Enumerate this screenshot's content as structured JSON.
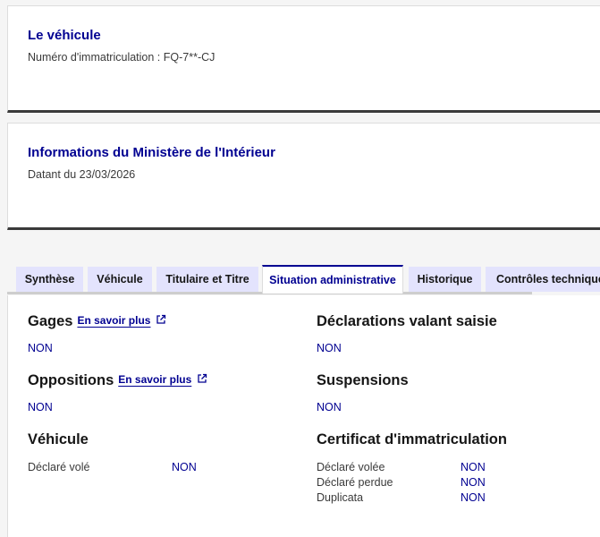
{
  "vehicle_card": {
    "title": "Le véhicule",
    "plate_label": "Numéro d'immatriculation : FQ-7**-CJ"
  },
  "ministry_card": {
    "title": "Informations du Ministère de l'Intérieur",
    "date_label": "Datant du 23/03/2026"
  },
  "tabs": [
    {
      "label": "Synthèse"
    },
    {
      "label": "Véhicule"
    },
    {
      "label": "Titulaire et Titre"
    },
    {
      "label": "Situation administrative",
      "active": true
    },
    {
      "label": "Historique"
    },
    {
      "label": "Contrôles techniques"
    }
  ],
  "sections": {
    "gages": {
      "title": "Gages",
      "link": "En savoir plus",
      "value": "NON"
    },
    "declarations": {
      "title": "Déclarations valant saisie",
      "value": "NON"
    },
    "oppositions": {
      "title": "Oppositions",
      "link": "En savoir plus",
      "value": "NON"
    },
    "suspensions": {
      "title": "Suspensions",
      "value": "NON"
    },
    "vehicule": {
      "title": "Véhicule",
      "rows": [
        {
          "label": "Déclaré volé",
          "value": "NON"
        }
      ]
    },
    "certificat": {
      "title": "Certificat d'immatriculation",
      "rows": [
        {
          "label": "Déclaré volée",
          "value": "NON"
        },
        {
          "label": "Déclaré perdue",
          "value": "NON"
        },
        {
          "label": "Duplicata",
          "value": "NON"
        }
      ]
    }
  },
  "colors": {
    "accent": "#000091",
    "tab_bg": "#e3e3fd",
    "text": "#161616",
    "muted": "#3a3a3a"
  }
}
